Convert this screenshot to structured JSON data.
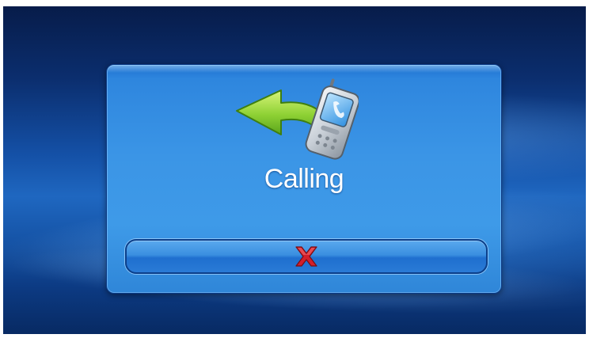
{
  "dialog": {
    "status_text": "Calling",
    "icon": "phone-calling-icon",
    "hangup_icon": "cancel-x-icon"
  },
  "colors": {
    "dialog_blue": "#3b95e6",
    "arrow_green": "#8ed134",
    "cancel_red": "#d21f2a"
  }
}
